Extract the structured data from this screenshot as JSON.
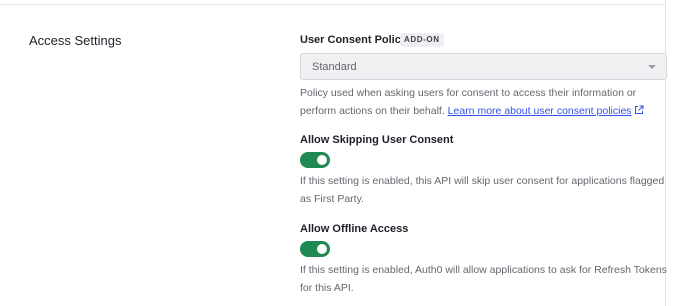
{
  "section": {
    "title": "Access Settings"
  },
  "consent_policy": {
    "label": "User Consent Policy",
    "badge": "ADD-ON",
    "selected": "Standard",
    "description": "Policy used when asking users for consent to access their information or perform actions on their behalf.",
    "learn_more_link": "Learn more about user consent policies",
    "link_icon": "external-link-icon"
  },
  "allow_skipping_consent": {
    "label": "Allow Skipping User Consent",
    "enabled": true,
    "description": "If this setting is enabled, this API will skip user consent for applications flagged as First Party."
  },
  "allow_offline_access": {
    "label": "Allow Offline Access",
    "enabled": true,
    "description": "If this setting is enabled, Auth0 will allow applications to ask for Refresh Tokens for this API."
  },
  "colors": {
    "toggle_on": "#1e8a52",
    "link": "#3553e2",
    "muted_text": "#65676e"
  }
}
